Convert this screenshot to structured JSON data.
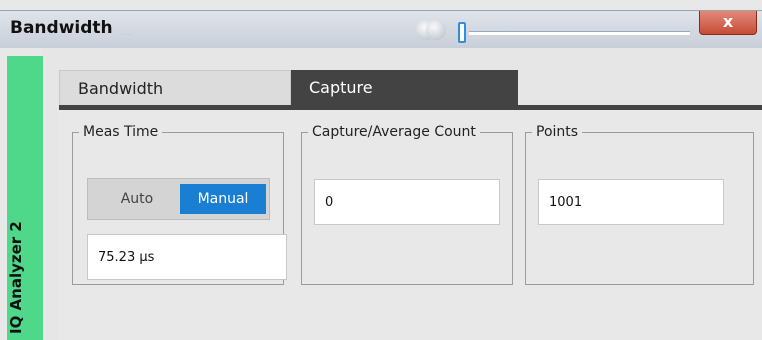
{
  "window": {
    "title": "Bandwidth",
    "close_label": "x"
  },
  "side_tab": {
    "label": "IQ Analyzer 2",
    "color": "#4fd88a"
  },
  "tabs": [
    {
      "label": "Bandwidth",
      "active": false
    },
    {
      "label": "Capture",
      "active": true
    }
  ],
  "meas_time": {
    "legend": "Meas Time",
    "toggle": {
      "options": [
        "Auto",
        "Manual"
      ],
      "selected": "Manual"
    },
    "value": "75.23 µs"
  },
  "capture_average": {
    "legend": "Capture/Average Count",
    "value": "0"
  },
  "points": {
    "legend": "Points",
    "value": "1001"
  },
  "colors": {
    "accent": "#1a7fd3",
    "active_tab": "#434343",
    "close_button": "#c64d37"
  }
}
